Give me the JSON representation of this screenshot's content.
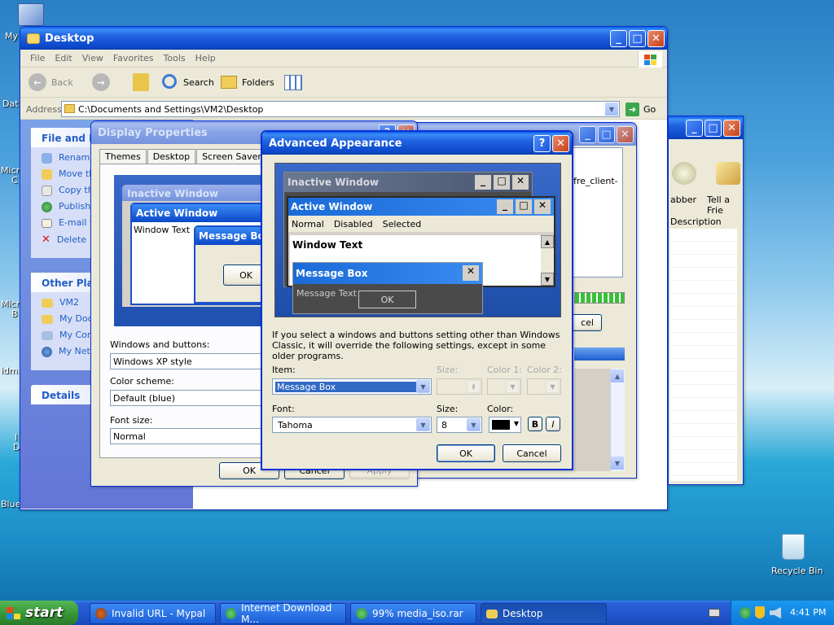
{
  "desktop_icons": [
    {
      "id": "my-computer",
      "label": "My"
    },
    {
      "id": "data",
      "label": "Dat"
    },
    {
      "id": "micro1",
      "label": "Micro"
    },
    {
      "id": "micro1b",
      "label": "C"
    },
    {
      "id": "micro2",
      "label": "Micro"
    },
    {
      "id": "micro2b",
      "label": "B"
    },
    {
      "id": "idma",
      "label": "idma"
    },
    {
      "id": "i",
      "label": "I"
    },
    {
      "id": "d",
      "label": "D"
    },
    {
      "id": "blue",
      "label": "Blue"
    }
  ],
  "recycle_bin": {
    "label": "Recycle Bin"
  },
  "explorer": {
    "title": "Desktop",
    "menu": [
      "File",
      "Edit",
      "View",
      "Favorites",
      "Tools",
      "Help"
    ],
    "back": "Back",
    "search": "Search",
    "folders": "Folders",
    "address_label": "Address",
    "address": "C:\\Documents and Settings\\VM2\\Desktop",
    "go": "Go",
    "file_tasks_title": "File and Fo",
    "file_tasks": [
      "Rename",
      "Move th",
      "Copy th",
      "Publish",
      "E-mail t",
      "Delete"
    ],
    "other_places_title": "Other Plac",
    "other_places": [
      "VM2",
      "My Doc",
      "My Com",
      "My Netw"
    ],
    "details_title": "Details"
  },
  "bg_window": {
    "text": "fre_client-",
    "button": "cel"
  },
  "right_window": {
    "items": [
      "abber",
      "Tell a Frie"
    ],
    "column": "Description"
  },
  "display_props": {
    "title": "Display Properties",
    "tabs": [
      "Themes",
      "Desktop",
      "Screen Saver",
      "Ap"
    ],
    "preview": {
      "inactive": "Inactive Window",
      "active": "Active Window",
      "window_text": "Window Text",
      "message_box": "Message Box",
      "ok": "OK"
    },
    "windows_buttons_label": "Windows and buttons:",
    "windows_buttons_value": "Windows XP style",
    "color_scheme_label": "Color scheme:",
    "color_scheme_value": "Default (blue)",
    "font_size_label": "Font size:",
    "font_size_value": "Normal",
    "ok": "OK",
    "cancel": "Cancel",
    "apply": "Apply"
  },
  "advanced": {
    "title": "Advanced Appearance",
    "preview": {
      "inactive": "Inactive Window",
      "active": "Active Window",
      "menu": [
        "Normal",
        "Disabled",
        "Selected"
      ],
      "window_text": "Window Text",
      "message_box": "Message Box",
      "message_text": "Message Text",
      "ok": "OK"
    },
    "info": "If you select a windows and buttons setting other than Windows Classic, it will override the following settings, except in some older programs.",
    "item_label": "Item:",
    "item_value": "Message Box",
    "size_label": "Size:",
    "color1_label": "Color 1:",
    "color2_label": "Color 2:",
    "font_label": "Font:",
    "font_value": "Tahoma",
    "font_size_value": "8",
    "color_label": "Color:",
    "bold": "B",
    "italic": "I",
    "ok": "OK",
    "cancel": "Cancel"
  },
  "taskbar": {
    "start": "start",
    "items": [
      "Invalid URL - Mypal",
      "Internet Download M...",
      "99% media_iso.rar",
      "Desktop"
    ],
    "clock": "4:41 PM"
  },
  "colors": {
    "accent": "#0a5fe8",
    "taskbar": "#245edb",
    "start": "#3c9a3c"
  }
}
